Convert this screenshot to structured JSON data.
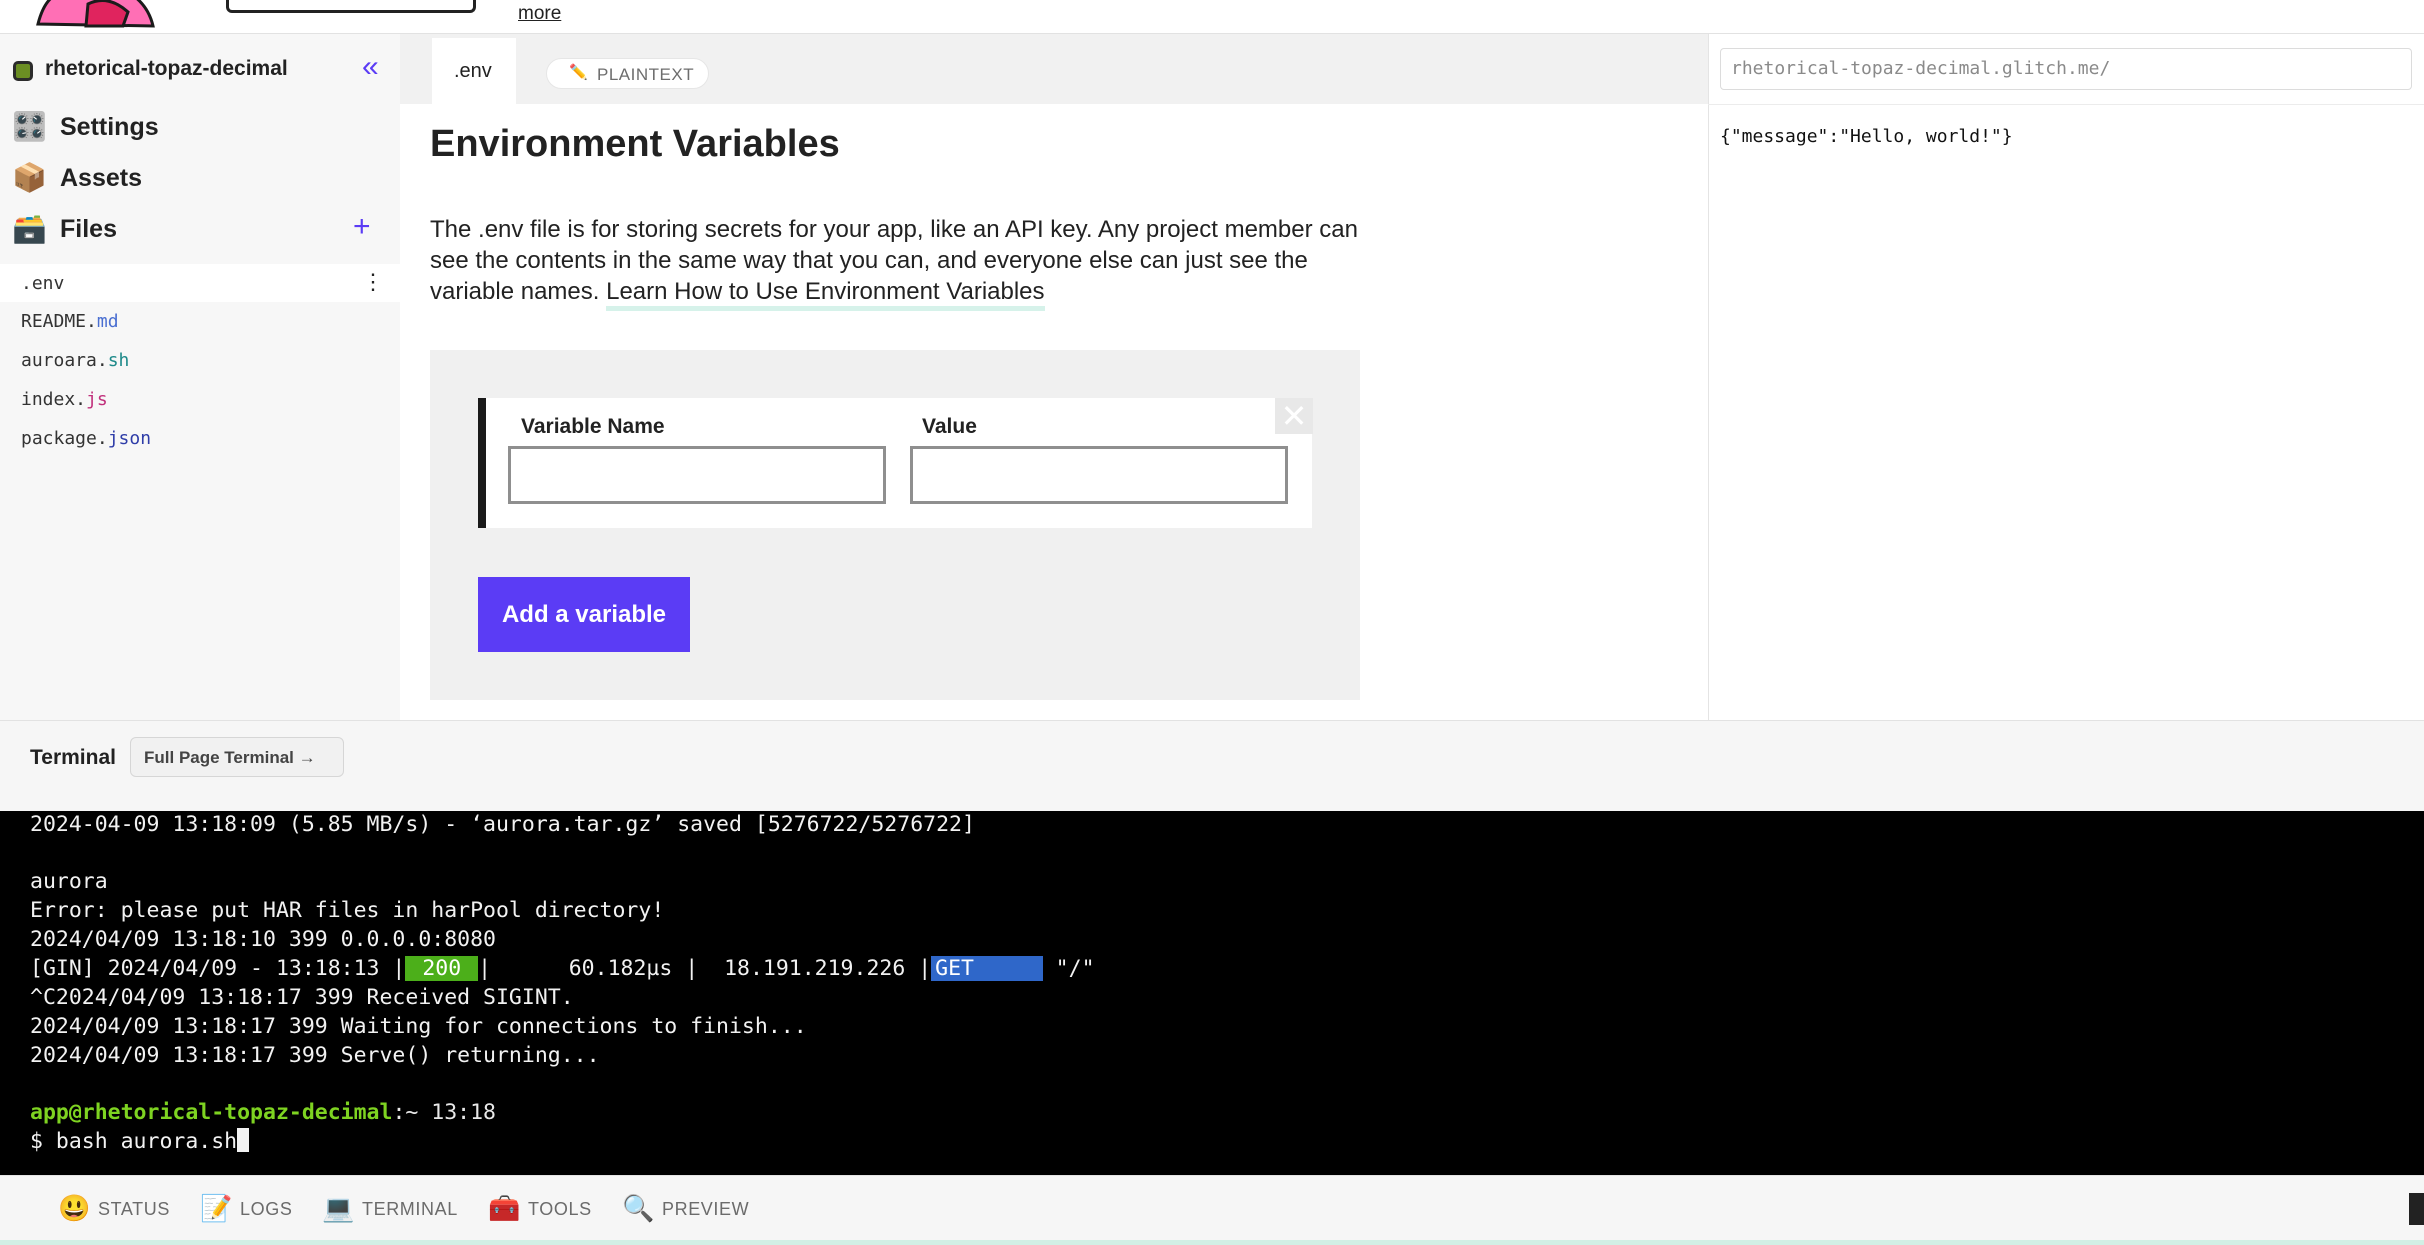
{
  "header": {
    "more_link": "more"
  },
  "sidebar": {
    "project_name": "rhetorical-topaz-decimal",
    "collapse_icon": "«",
    "nav": [
      {
        "label": "Settings",
        "icon": "settings-icon",
        "emoji": "🎛️"
      },
      {
        "label": "Assets",
        "icon": "assets-icon",
        "emoji": "📦"
      },
      {
        "label": "Files",
        "icon": "files-icon",
        "emoji": "🗃️"
      }
    ],
    "add_file_icon": "+",
    "files": [
      {
        "base": ".env",
        "ext": ""
      },
      {
        "base": "README.",
        "ext": "md"
      },
      {
        "base": "auroara.",
        "ext": "sh"
      },
      {
        "base": "index.",
        "ext": "js"
      },
      {
        "base": "package.",
        "ext": "json"
      }
    ],
    "kebab_icon": "⋮"
  },
  "editor": {
    "tab_label": ".env",
    "mode_icon": "✏️",
    "mode_label": "PLAINTEXT",
    "title": "Environment Variables",
    "description": "The .env file is for storing secrets for your app, like an API key. Any project member can see the contents in the same way that you can, and everyone else can just see the variable names. ",
    "learn_link": "Learn How to Use Environment Variables",
    "var_name_label": "Variable Name",
    "var_value_label": "Value",
    "var_name_value": "",
    "var_value_value": "",
    "remove_icon": "✕",
    "add_button": "Add a variable"
  },
  "preview": {
    "url": "rhetorical-topaz-decimal.glitch.me/",
    "body": "{\"message\":\"Hello, world!\"}"
  },
  "terminal": {
    "title": "Terminal",
    "full_page_button": "Full Page Terminal →",
    "lines": {
      "l1": "2024-04-09 13:18:09 (5.85 MB/s) - ‘aurora.tar.gz’ saved [5276722/5276722]",
      "l2": "aurora",
      "l3": "Error: please put HAR files in harPool directory!",
      "l4": "2024/04/09 13:18:10 399 0.0.0.0:8080",
      "gin_prefix": "[GIN] 2024/04/09 - 13:18:13 |",
      "gin_status": " 200 ",
      "gin_mid": "|      60.182µs |  18.191.219.226 |",
      "gin_method": "GET     ",
      "gin_path": " \"/\"",
      "l6": "^C2024/04/09 13:18:17 399 Received SIGINT.",
      "l7": "2024/04/09 13:18:17 399 Waiting for connections to finish...",
      "l8": "2024/04/09 13:18:17 399 Serve() returning...",
      "prompt_user": "app@rhetorical-topaz-decimal",
      "prompt_rest": ":~ 13:18",
      "command": "$ bash aurora.sh"
    },
    "colors": {
      "status_200": "#4caf1a",
      "method_get": "#2f67c9",
      "prompt": "#7ed321"
    }
  },
  "bottombar": {
    "items": [
      {
        "label": "STATUS",
        "icon": "status-icon",
        "emoji": "😃"
      },
      {
        "label": "LOGS",
        "icon": "logs-icon",
        "emoji": "📝"
      },
      {
        "label": "TERMINAL",
        "icon": "terminal-icon",
        "emoji": "💻"
      },
      {
        "label": "TOOLS",
        "icon": "tools-icon",
        "emoji": "🧰"
      },
      {
        "label": "PREVIEW",
        "icon": "preview-icon",
        "emoji": "🔍"
      }
    ]
  },
  "colors": {
    "accent": "#5b3cf5",
    "link_underline": "#d6f2ea"
  }
}
